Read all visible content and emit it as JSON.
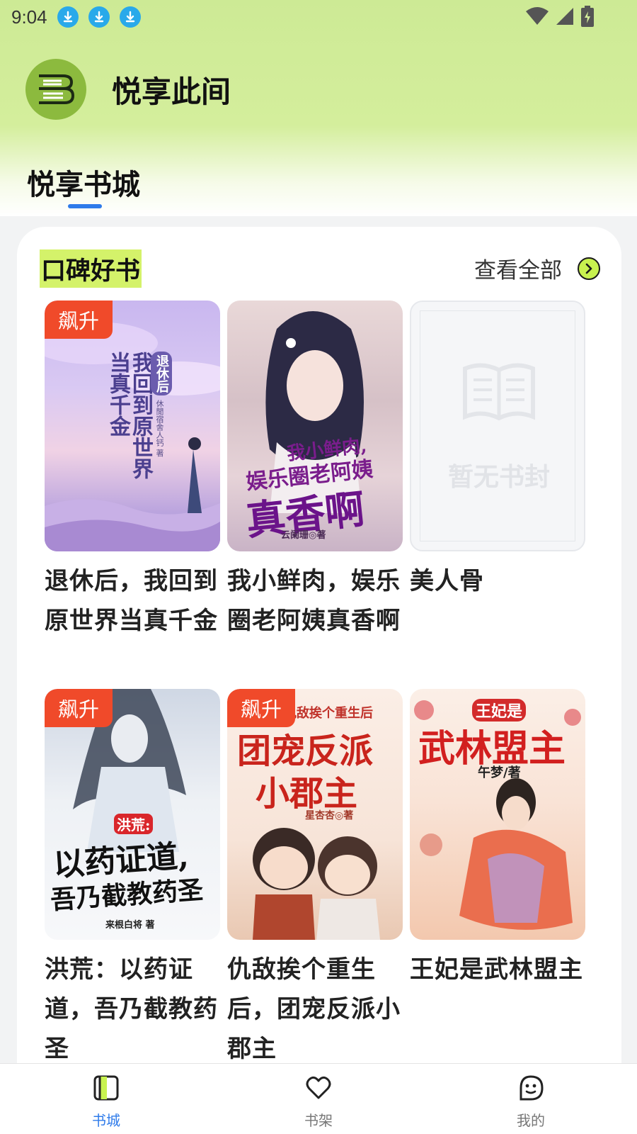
{
  "status_bar": {
    "time": "9:04",
    "download_icons": [
      "download-icon",
      "download-icon",
      "download-icon"
    ],
    "right_icons": [
      "wifi-icon",
      "signal-icon",
      "battery-icon"
    ]
  },
  "app": {
    "title": "悦享此间",
    "logo_icon": "book-logo-icon"
  },
  "tabs": [
    {
      "label": "悦享书城",
      "active": true
    }
  ],
  "section": {
    "title": "口碑好书",
    "view_all_label": "查看全部",
    "accent": "#d4f26a"
  },
  "books": [
    {
      "title": "退休后，我回到原世界当真千金",
      "badge": "飙升",
      "cover_text": [
        "当真千金",
        "我回到原世界",
        "退休后"
      ],
      "cover_author": "休閒宿舍人钙 著"
    },
    {
      "title": "我小鲜肉，娱乐圈老阿姨真香啊",
      "badge": "",
      "cover_text": [
        "我小鲜肉,",
        "娱乐圈老阿姨",
        "真香啊"
      ],
      "cover_author": "云阑珊◎著"
    },
    {
      "title": "美人骨",
      "badge": "",
      "cover_text": [
        "暂无书封"
      ],
      "cover_author": ""
    },
    {
      "title": "洪荒：以药证道，吾乃截教药圣",
      "badge": "飙升",
      "cover_text": [
        "洪荒:",
        "以药证道,",
        "吾乃截教药圣"
      ],
      "cover_author": "来根白将 著"
    },
    {
      "title": "仇敌挨个重生后，团宠反派小郡主",
      "badge": "飙升",
      "cover_text": [
        "仇敌挨个重生后",
        "团宠反派",
        "小郡主"
      ],
      "cover_author": "星杏杏◎著"
    },
    {
      "title": "王妃是武林盟主",
      "badge": "",
      "cover_text": [
        "王妃是",
        "武林盟主"
      ],
      "cover_author": "午梦/著"
    }
  ],
  "bottom_nav": [
    {
      "label": "书城",
      "icon": "bookstore-icon",
      "active": true,
      "color": "#2f7bea"
    },
    {
      "label": "书架",
      "icon": "heart-icon",
      "active": false,
      "color": "#777777"
    },
    {
      "label": "我的",
      "icon": "profile-face-icon",
      "active": false,
      "color": "#777777"
    }
  ]
}
